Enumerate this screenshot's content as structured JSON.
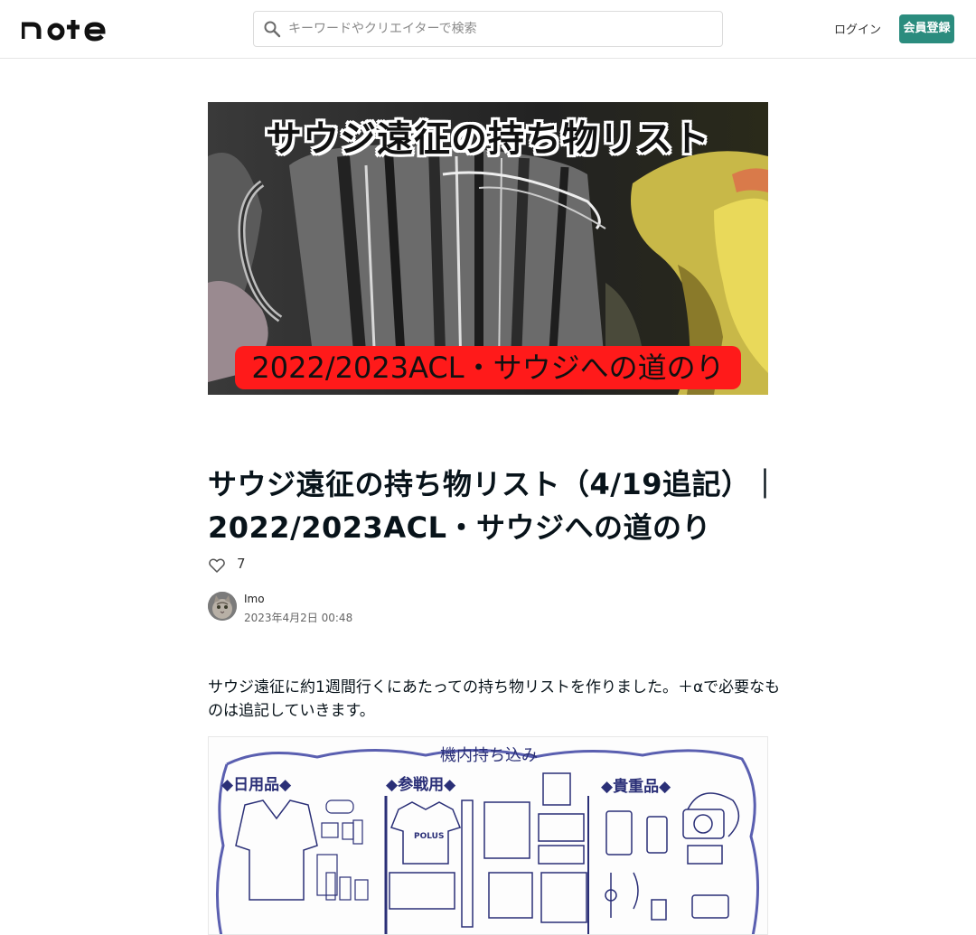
{
  "header": {
    "logo_text": "note",
    "search": {
      "placeholder": "キーワードやクリエイターで検索"
    },
    "login_label": "ログイン",
    "signup_label": "会員登録",
    "accent_color": "#2b8c7e"
  },
  "hero": {
    "title": "サウジ遠征の持ち物リスト",
    "subtitle": "2022/2023ACL・サウジへの道のり"
  },
  "article": {
    "title": "サウジ遠征の持ち物リスト（4/19追記）｜2022/2023ACL・サウジへの道のり",
    "title_line1": "サウジ遠征の持ち物リスト（4/19追記）｜",
    "title_line2": "2022/2023ACL・サウジへの道のり",
    "like_count": "7",
    "author": {
      "name": "Imo",
      "date": "2023年4月2日 00:48"
    },
    "body_intro": "サウジ遠征に約1週間行くにあたっての持ち物リストを作りました。＋αで必要なものは追記していきます。"
  },
  "illustration": {
    "heading": "機内持ち込み",
    "categories": [
      "◆日用品◆",
      "◆参戦用◆",
      "◆貴重品◆"
    ]
  },
  "icons": [
    "search-icon",
    "heart-icon",
    "avatar-cat-icon"
  ]
}
